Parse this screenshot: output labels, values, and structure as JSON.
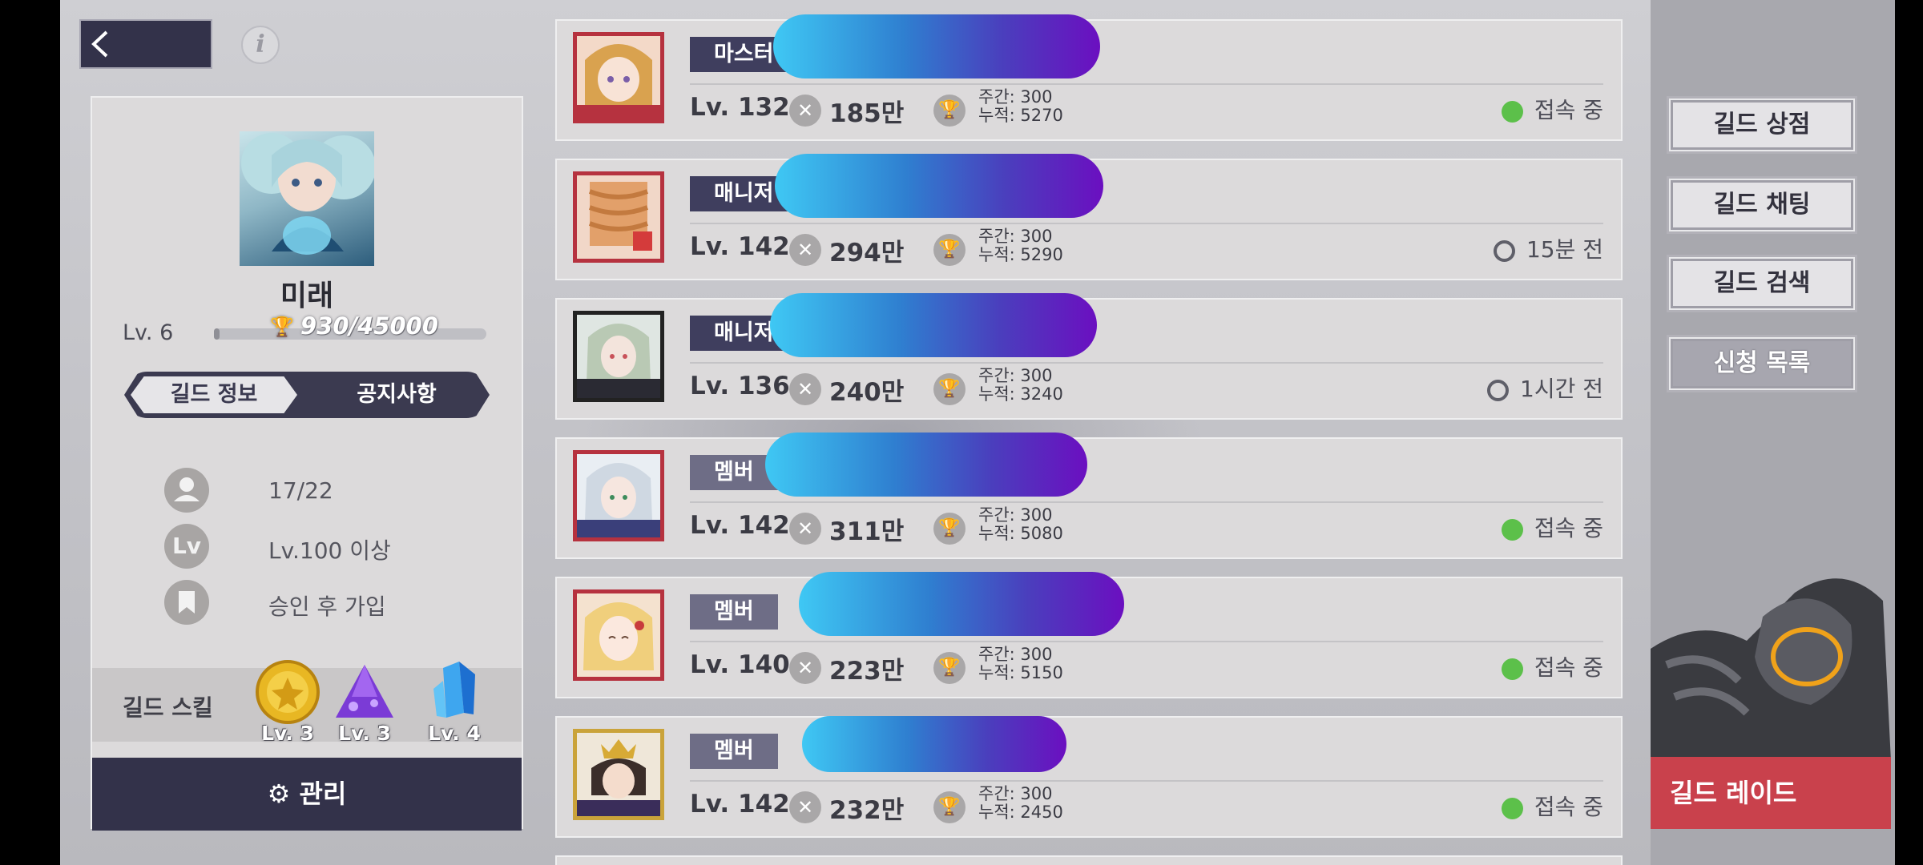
{
  "nav": {
    "back_icon": "back-chevron-icon",
    "info_label": "i"
  },
  "guild": {
    "name": "미래",
    "level": "Lv. 6",
    "xp": "930/45000",
    "xp_fraction": 0.0207,
    "tabs": [
      {
        "label": "길드 정보",
        "active": true
      },
      {
        "label": "공지사항",
        "active": false
      }
    ],
    "stats": [
      {
        "icon": "person-icon",
        "text": "17/22"
      },
      {
        "icon": "level-icon",
        "glyph": "Lv",
        "text": "Lv.100 이상"
      },
      {
        "icon": "bookmark-icon",
        "text": "승인 후 가입"
      }
    ],
    "skills_label": "길드 스킬",
    "skills": [
      {
        "icon": "gold-coin-icon",
        "level": "Lv. 3"
      },
      {
        "icon": "purple-crystal-icon",
        "level": "Lv. 3"
      },
      {
        "icon": "blue-crystal-icon",
        "level": "Lv. 4"
      }
    ],
    "manage_label": "관리",
    "manage_icon": "gear-icon"
  },
  "members": [
    {
      "role": "마스터",
      "level": "Lv. 132",
      "power": "185만",
      "weekly": "주간: 300",
      "total": "누적: 5270",
      "status": "접속 중",
      "online": true
    },
    {
      "role": "매니저",
      "level": "Lv. 142",
      "power": "294만",
      "weekly": "주간: 300",
      "total": "누적: 5290",
      "status": "15분 전",
      "online": false
    },
    {
      "role": "매니저",
      "level": "Lv. 136",
      "power": "240만",
      "weekly": "주간: 300",
      "total": "누적: 3240",
      "status": "1시간 전",
      "online": false
    },
    {
      "role": "멤버",
      "level": "Lv. 142",
      "power": "311만",
      "weekly": "주간: 300",
      "total": "누적: 5080",
      "status": "접속 중",
      "online": true
    },
    {
      "role": "멤버",
      "level": "Lv. 140",
      "power": "223만",
      "weekly": "주간: 300",
      "total": "누적: 5150",
      "status": "접속 중",
      "online": true
    },
    {
      "role": "멤버",
      "level": "Lv. 142",
      "power": "232만",
      "weekly": "주간: 300",
      "total": "누적: 2450",
      "status": "접속 중",
      "online": true
    }
  ],
  "right": {
    "shop": "길드 상점",
    "chat": "길드 채팅",
    "search": "길드 검색",
    "requests": "신청 목록",
    "raid": "길드 레이드"
  },
  "colors": {
    "panel_dark": "#33324a",
    "online": "#5cc04a",
    "raid": "#c9414c"
  }
}
